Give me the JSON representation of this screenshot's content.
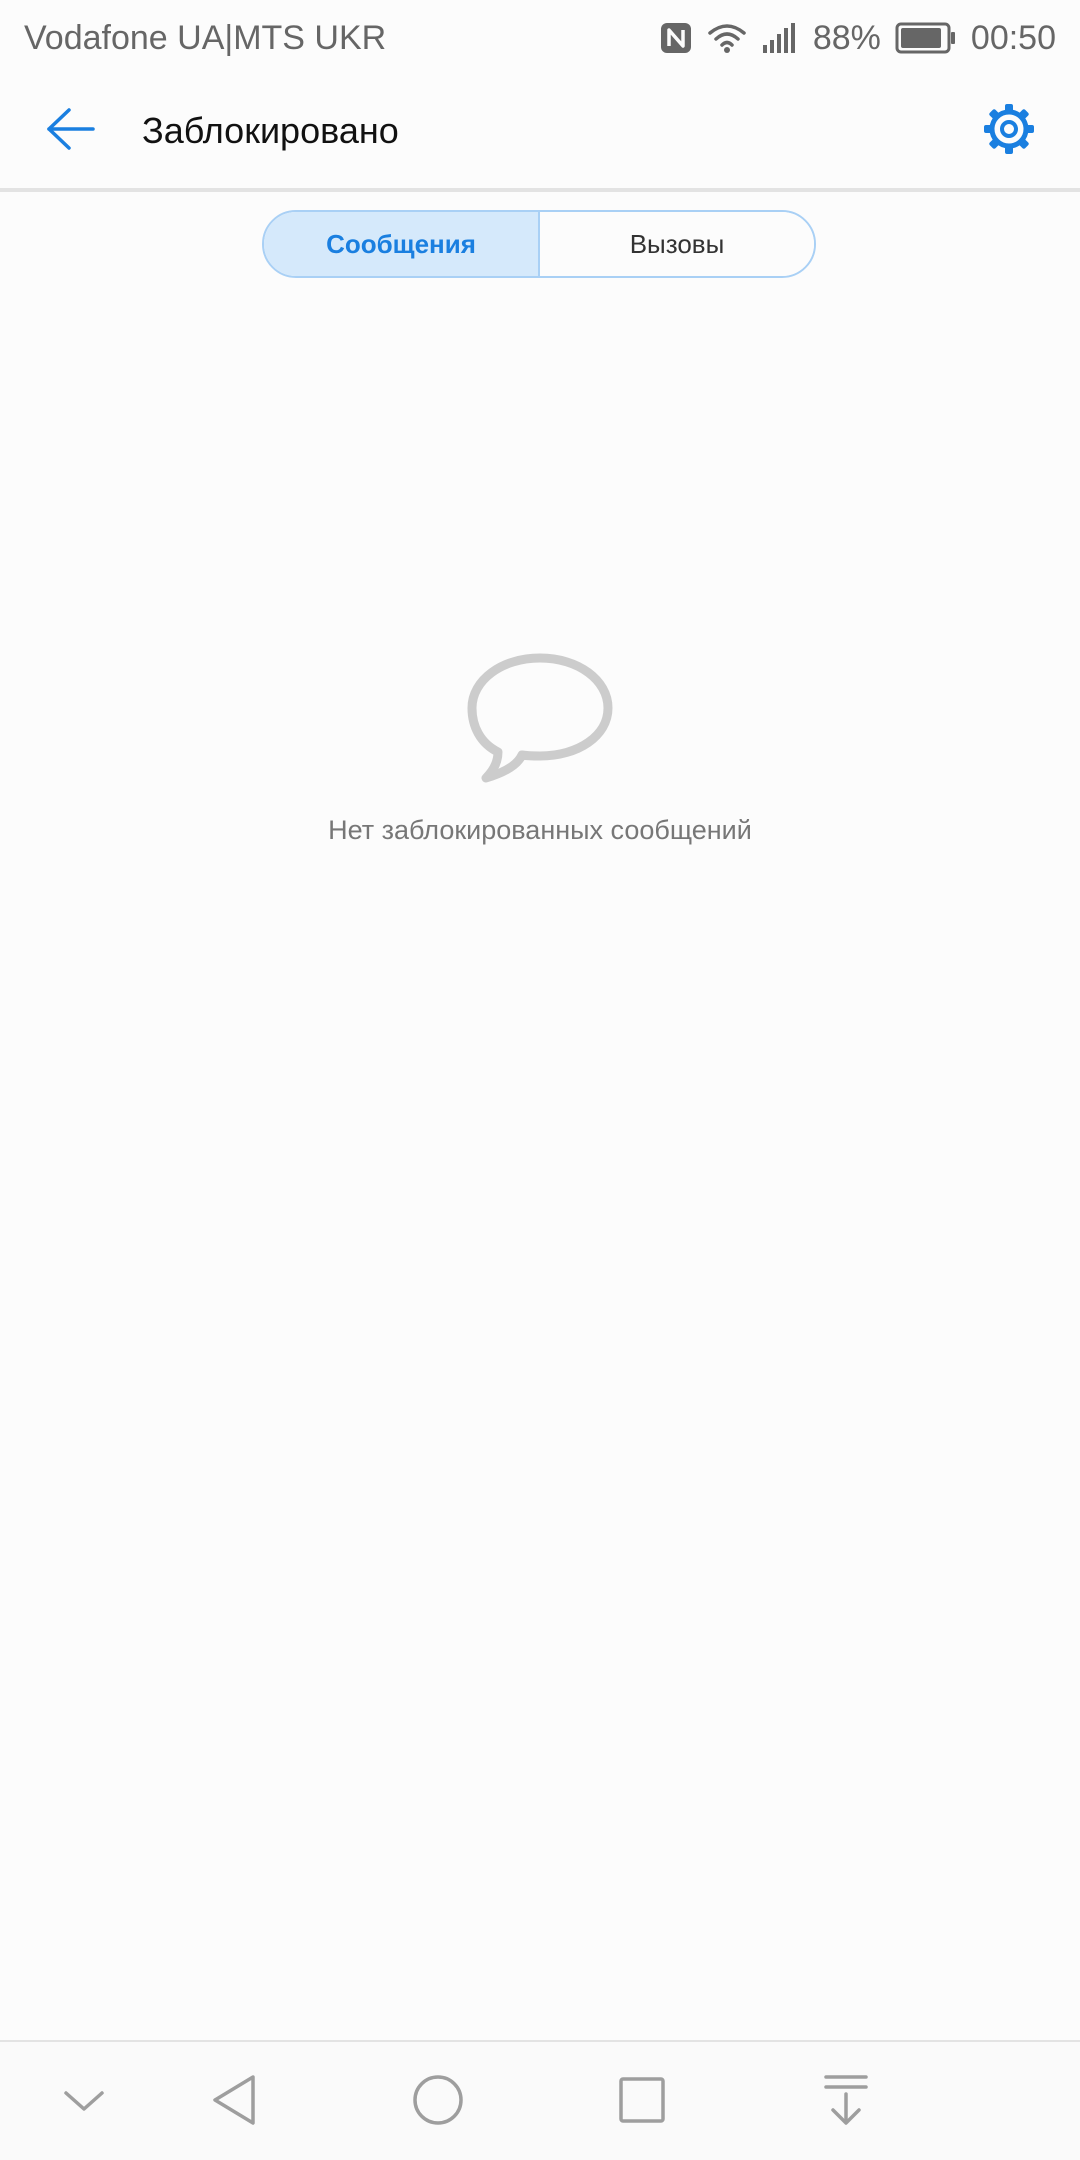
{
  "status_bar": {
    "carrier": "Vodafone UA|MTS UKR",
    "battery_percent": "88%",
    "time": "00:50",
    "icons": [
      "nfc-icon",
      "wifi-icon",
      "signal-icon",
      "battery-icon"
    ]
  },
  "app_bar": {
    "title": "Заблокировано",
    "back_icon": "arrow-left-icon",
    "settings_icon": "gear-icon"
  },
  "tabs": [
    {
      "label": "Сообщения",
      "active": true
    },
    {
      "label": "Вызовы",
      "active": false
    }
  ],
  "empty_state": {
    "icon": "speech-bubble-icon",
    "text": "Нет заблокированных сообщений"
  },
  "nav_bar": {
    "icons": [
      "chevron-down-icon",
      "back-triangle-icon",
      "home-circle-icon",
      "recents-square-icon",
      "notification-pulldown-icon"
    ]
  },
  "colors": {
    "accent": "#1a7fe0",
    "tab_active_bg": "#d5e9fb",
    "tab_border": "#a9d0f5",
    "muted_text": "#777777",
    "background": "#fcfcfc"
  }
}
